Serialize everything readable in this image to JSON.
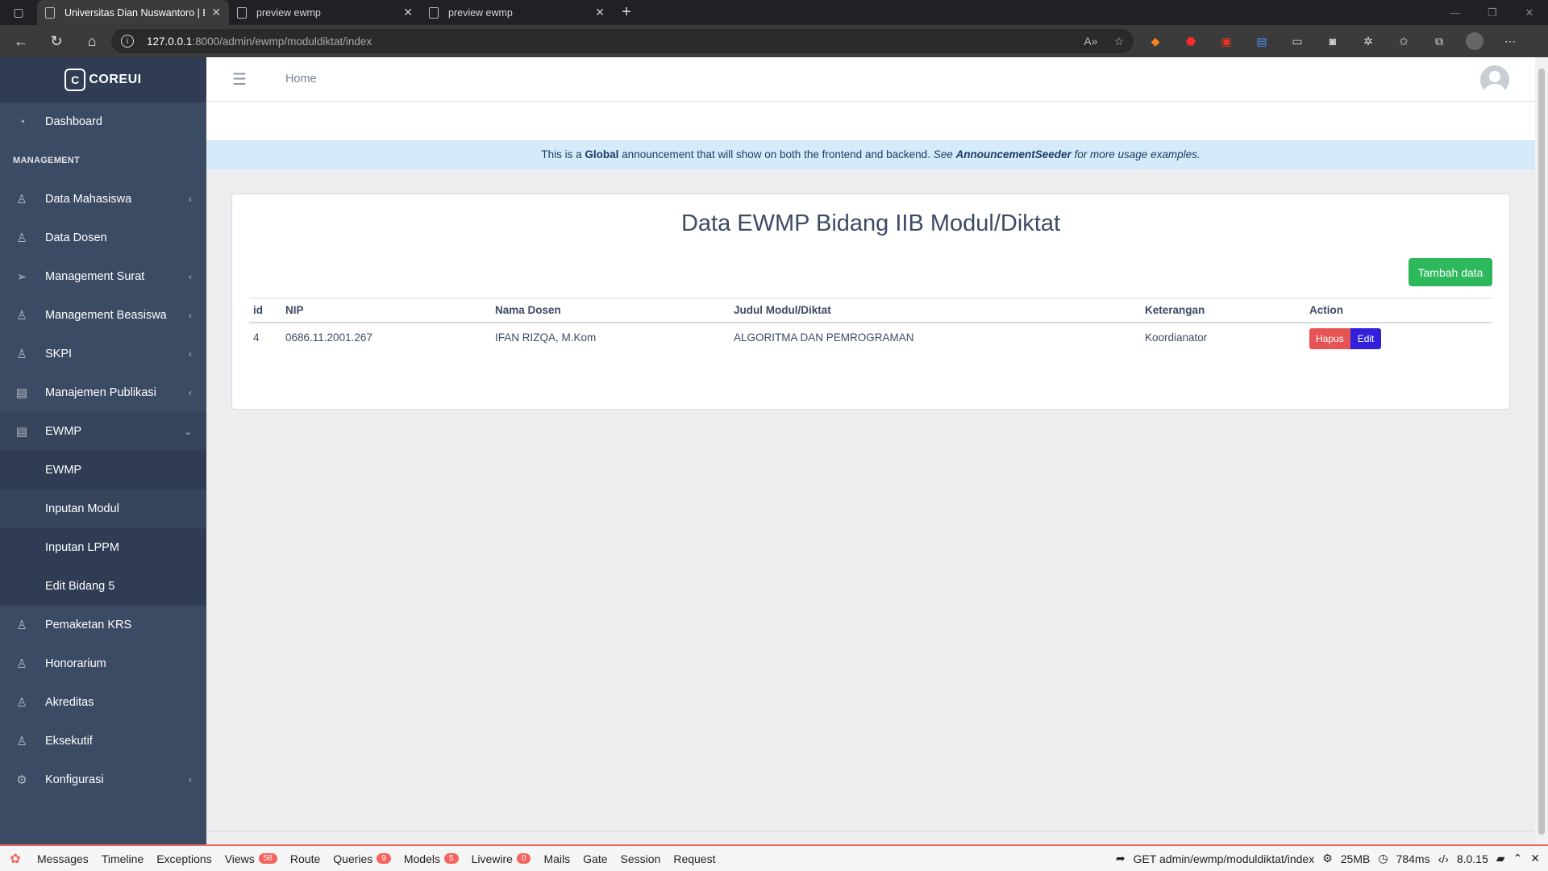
{
  "browser": {
    "tabs": [
      {
        "label": "Universitas Dian Nuswantoro | E",
        "active": true
      },
      {
        "label": "preview ewmp",
        "active": false
      },
      {
        "label": "preview ewmp",
        "active": false
      }
    ],
    "url_host": "127.0.0.1",
    "url_path": ":8000/admin/ewmp/moduldiktat/index"
  },
  "sidebar": {
    "brand": "COREUI",
    "dashboard": "Dashboard",
    "section_title": "MANAGEMENT",
    "items": [
      {
        "label": "Data Mahasiswa",
        "icon": "user-icon",
        "chevron": "‹"
      },
      {
        "label": "Data Dosen",
        "icon": "user-icon",
        "chevron": ""
      },
      {
        "label": "Management Surat",
        "icon": "send-icon",
        "chevron": "‹"
      },
      {
        "label": "Management Beasiswa",
        "icon": "user-icon",
        "chevron": "‹"
      },
      {
        "label": "SKPI",
        "icon": "user-icon",
        "chevron": "‹"
      },
      {
        "label": "Manajemen Publikasi",
        "icon": "newspaper-icon",
        "chevron": "‹"
      },
      {
        "label": "EWMP",
        "icon": "newspaper-icon",
        "chevron": "⌄"
      }
    ],
    "sub_items": [
      "EWMP",
      "Inputan Modul",
      "Inputan LPPM",
      "Edit Bidang 5"
    ],
    "bottom_items": [
      {
        "label": "Pemaketan KRS",
        "chevron": ""
      },
      {
        "label": "Honorarium",
        "chevron": ""
      },
      {
        "label": "Akreditas",
        "chevron": ""
      },
      {
        "label": "Eksekutif",
        "chevron": ""
      },
      {
        "label": "Konfigurasi",
        "chevron": "‹"
      }
    ]
  },
  "header": {
    "breadcrumb_home": "Home"
  },
  "announcement": {
    "pre": "This is a ",
    "bold": "Global",
    "mid": " announcement that will show on both the frontend and backend. ",
    "italic_pre": "See ",
    "italic_bold": "AnnouncementSeeder",
    "italic_post": " for more usage examples."
  },
  "card": {
    "title": "Data EWMP Bidang IIB Modul/Diktat",
    "add_button": "Tambah data",
    "columns": [
      "id",
      "NIP",
      "Nama Dosen",
      "Judul Modul/Diktat",
      "Keterangan",
      "Action"
    ],
    "rows": [
      {
        "id": "4",
        "nip": "0686.11.2001.267",
        "nama": "IFAN RIZQA, M.Kom",
        "judul": "ALGORITMA DAN PEMROGRAMAN",
        "keterangan": "Koordianator",
        "delete_label": "Hapus",
        "edit_label": "Edit"
      }
    ]
  },
  "debugbar": {
    "items": [
      {
        "label": "Messages",
        "badge": ""
      },
      {
        "label": "Timeline",
        "badge": ""
      },
      {
        "label": "Exceptions",
        "badge": ""
      },
      {
        "label": "Views",
        "badge": "58"
      },
      {
        "label": "Route",
        "badge": ""
      },
      {
        "label": "Queries",
        "badge": "9"
      },
      {
        "label": "Models",
        "badge": "5"
      },
      {
        "label": "Livewire",
        "badge": "0"
      },
      {
        "label": "Mails",
        "badge": ""
      },
      {
        "label": "Gate",
        "badge": ""
      },
      {
        "label": "Session",
        "badge": ""
      },
      {
        "label": "Request",
        "badge": ""
      }
    ],
    "route": "GET admin/ewmp/moduldiktat/index",
    "memory": "25MB",
    "time": "784ms",
    "php": "8.0.15"
  },
  "colors": {
    "sidebar_bg": "#3c4b64",
    "success": "#2eb85c",
    "danger": "#e55353",
    "primary": "#321fdb",
    "info_bg": "#d6ebfa"
  }
}
